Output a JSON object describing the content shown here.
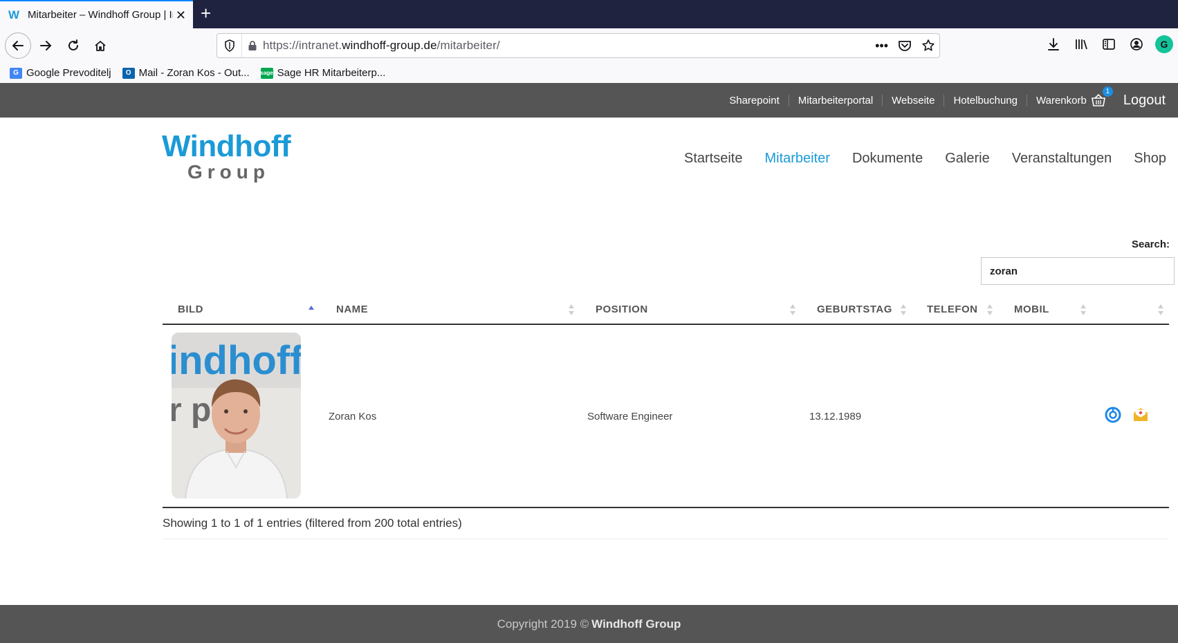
{
  "browser": {
    "tab_title": "Mitarbeiter – Windhoff Group | Intranet",
    "tab_favicon": "W",
    "url_prefix": "https://intranet.",
    "url_domain": "windhoff-group.de",
    "url_path": "/mitarbeiter/",
    "url_more": "•••",
    "bookmarks": [
      {
        "label": "Google Prevoditelj",
        "icon": "google-translate-icon"
      },
      {
        "label": "Mail - Zoran Kos - Out...",
        "icon": "outlook-icon"
      },
      {
        "label": "Sage HR Mitarbeiterp...",
        "icon": "sage-icon"
      }
    ]
  },
  "topbar": {
    "links": [
      "Sharepoint",
      "Mitarbeiterportal",
      "Webseite",
      "Hotelbuchung"
    ],
    "cart_label": "Warenkorb",
    "cart_count": "1",
    "logout": "Logout"
  },
  "logo": {
    "top": "Windhoff",
    "bottom": "Group"
  },
  "mainnav": {
    "items": [
      "Startseite",
      "Mitarbeiter",
      "Dokumente",
      "Galerie",
      "Veranstaltungen",
      "Shop"
    ],
    "active": "Mitarbeiter"
  },
  "search": {
    "label": "Search:",
    "value": "zoran"
  },
  "table": {
    "headers": [
      "BILD",
      "NAME",
      "POSITION",
      "GEBURTSTAG",
      "TELEFON",
      "MOBIL"
    ],
    "rows": [
      {
        "name": "Zoran Kos",
        "position": "Software Engineer",
        "birthday": "13.12.1989",
        "telefon": "",
        "mobil": ""
      }
    ],
    "photo_banner_top": "indhoff",
    "photo_banner_bottom": "r  p"
  },
  "info": "Showing 1 to 1 of 1 entries (filtered from 200 total entries)",
  "footer": {
    "prefix": "Copyright 2019 ©",
    "brand": "Windhoff Group"
  },
  "colors": {
    "accent": "#1b9ad7",
    "bar": "#555555",
    "browser_dark": "#202340"
  }
}
